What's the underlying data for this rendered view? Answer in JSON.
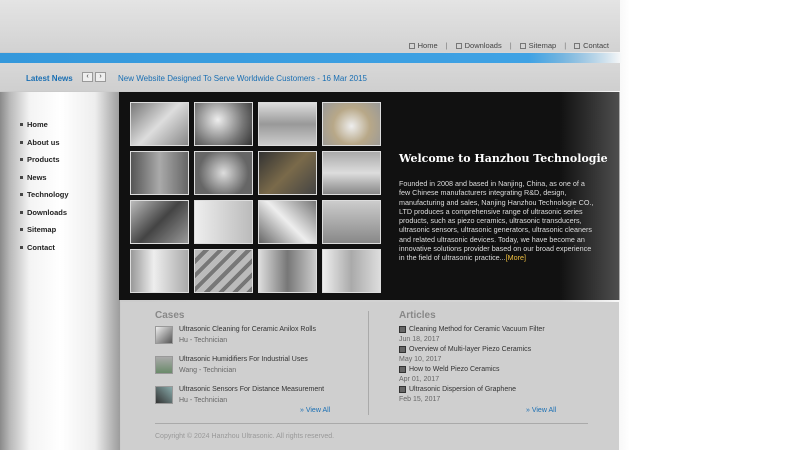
{
  "header": {
    "links": [
      {
        "label": "Home",
        "icon": "home-icon"
      },
      {
        "label": "Downloads",
        "icon": "download-icon"
      },
      {
        "label": "Sitemap",
        "icon": "sitemap-icon"
      },
      {
        "label": "Contact",
        "icon": "contact-icon"
      }
    ],
    "separator": "|"
  },
  "news": {
    "label": "Latest News",
    "prev": "‹",
    "next": "›",
    "headline": "New Website Designed To Serve Worldwide Customers - 16 Mar 2015"
  },
  "sidebar": {
    "items": [
      "Home",
      "About us",
      "Products",
      "News",
      "Technology",
      "Downloads",
      "Sitemap",
      "Contact"
    ]
  },
  "hero": {
    "title": "Welcome to Hanzhou Technologie",
    "body": "Founded in 2008 and based in Nanjing, China, as one of a few Chinese manufacturers integrating R&D, design, manufacturing and sales, Nanjing Hanzhou Technologie CO., LTD produces a comprehensive range of ultrasonic series products, such as piezo ceramics, ultrasonic transducers, ultrasonic sensors, ultrasonic generators, ultrasonic cleaners and related ultrasonic devices. Today, we have become an innovative solutions provider based on our broad experience in the field of ultrasonic practice...",
    "more": "[More]",
    "colors": {
      "background": "#111111",
      "title": "#ffffff",
      "link": "#f0c040"
    }
  },
  "cases": {
    "title": "Cases",
    "items": [
      {
        "title": "Ultrasonic Cleaning for Ceramic Anilox Rolls",
        "meta": "Hu - Technician"
      },
      {
        "title": "Ultrasonic Humidifiers For Industrial Uses",
        "meta": "Wang - Technician"
      },
      {
        "title": "Ultrasonic Sensors For Distance Measurement",
        "meta": "Hu - Technician"
      }
    ],
    "view_all": "» View All"
  },
  "articles": {
    "title": "Articles",
    "items": [
      {
        "title": "Cleaning Method for Ceramic Vacuum Filter",
        "date": "Jun 18, 2017"
      },
      {
        "title": "Overview of Multi-layer Piezo Ceramics",
        "date": "May 10, 2017"
      },
      {
        "title": "How to Weld Piezo Ceramics",
        "date": "Apr 01, 2017"
      },
      {
        "title": "Ultrasonic Dispersion of Graphene",
        "date": "Feb 15, 2017"
      }
    ],
    "view_all": "» View All"
  },
  "footer": {
    "copyright": "Copyright © 2024 Hanzhou Ultrasonic. All rights reserved."
  },
  "accent_color": "#3498db"
}
